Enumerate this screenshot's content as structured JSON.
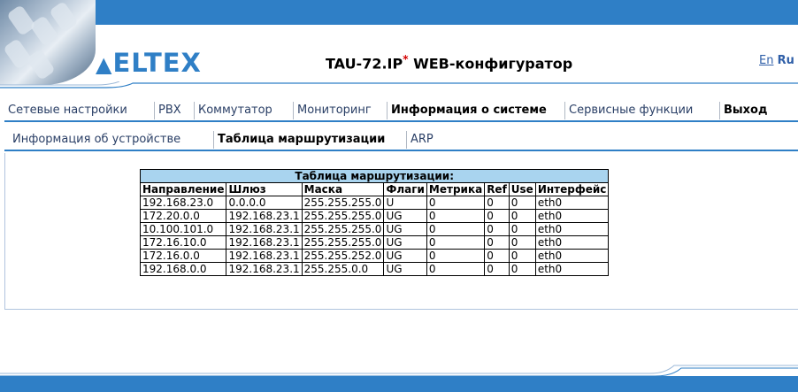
{
  "header": {
    "logo": "ELTEX",
    "title": "TAU-72.IP",
    "title_mark": "*",
    "title_suffix": " WEB-конфигуратор",
    "lang_en": "En",
    "lang_ru": "Ru"
  },
  "menu_main": [
    {
      "label": "Сетевые настройки"
    },
    {
      "label": "PBX"
    },
    {
      "label": "Коммутатор"
    },
    {
      "label": "Мониторинг"
    },
    {
      "label": "Информация о системе",
      "active": true
    },
    {
      "label": "Сервисные функции"
    },
    {
      "label": "Выход"
    }
  ],
  "menu_sub": [
    {
      "label": "Информация об устройстве"
    },
    {
      "label": "Таблица маршрутизации",
      "active": true
    },
    {
      "label": "ARP"
    }
  ],
  "routing": {
    "caption": "Таблица маршрутизации:",
    "headers": [
      "Направление",
      "Шлюз",
      "Маска",
      "Флаги",
      "Метрика",
      "Ref",
      "Use",
      "Интерфейс"
    ],
    "rows": [
      [
        "192.168.23.0",
        "0.0.0.0",
        "255.255.255.0",
        "U",
        "0",
        "0",
        "0",
        "eth0"
      ],
      [
        "172.20.0.0",
        "192.168.23.1",
        "255.255.255.0",
        "UG",
        "0",
        "0",
        "0",
        "eth0"
      ],
      [
        "10.100.101.0",
        "192.168.23.1",
        "255.255.255.0",
        "UG",
        "0",
        "0",
        "0",
        "eth0"
      ],
      [
        "172.16.10.0",
        "192.168.23.1",
        "255.255.255.0",
        "UG",
        "0",
        "0",
        "0",
        "eth0"
      ],
      [
        "172.16.0.0",
        "192.168.23.1",
        "255.255.252.0",
        "UG",
        "0",
        "0",
        "0",
        "eth0"
      ],
      [
        "192.168.0.0",
        "192.168.23.1",
        "255.255.0.0",
        "UG",
        "0",
        "0",
        "0",
        "eth0"
      ]
    ]
  },
  "colors": {
    "brand_blue": "#2f7fc6",
    "table_caption_bg": "#a9d4ef",
    "title_asterisk": "#d40000"
  }
}
